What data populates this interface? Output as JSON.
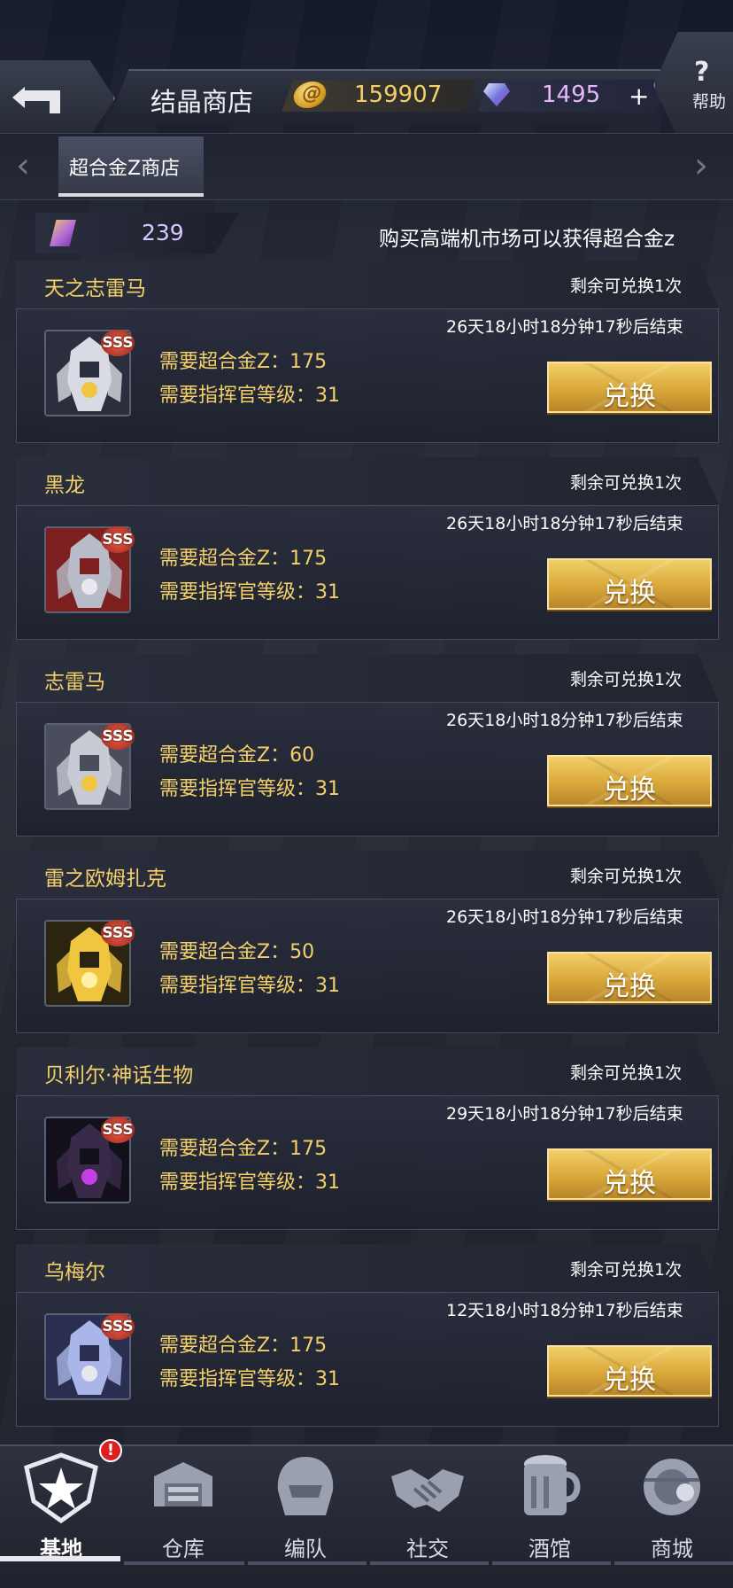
{
  "header": {
    "title": "结晶商店",
    "gold": "159907",
    "gems": "1495",
    "plus": "+",
    "help_label": "帮助",
    "help_glyph": "?"
  },
  "tabs": {
    "items": [
      {
        "label": "超合金Z商店",
        "active": true
      }
    ],
    "left_arrow": "‹",
    "right_arrow": "›"
  },
  "balance": {
    "alloy_count": "239",
    "hint": "购买高端机市场可以获得超合金z"
  },
  "items": [
    {
      "name": "天之志雷马",
      "remain": "剩余可兑换1次",
      "timer": "26天18小时18分钟17秒后结束",
      "rank": "SSS",
      "req_alloy": "需要超合金Z：175",
      "req_level": "需要指挥官等级：31",
      "button": "兑换",
      "portrait": "white-mecha"
    },
    {
      "name": "黑龙",
      "remain": "剩余可兑换1次",
      "timer": "26天18小时18分钟17秒后结束",
      "rank": "SSS",
      "req_alloy": "需要超合金Z：175",
      "req_level": "需要指挥官等级：31",
      "button": "兑换",
      "portrait": "red-mecha"
    },
    {
      "name": "志雷马",
      "remain": "剩余可兑换1次",
      "timer": "26天18小时18分钟17秒后结束",
      "rank": "SSS",
      "req_alloy": "需要超合金Z：60",
      "req_level": "需要指挥官等级：31",
      "button": "兑换",
      "portrait": "silver-mecha"
    },
    {
      "name": "雷之欧姆扎克",
      "remain": "剩余可兑换1次",
      "timer": "26天18小时18分钟17秒后结束",
      "rank": "SSS",
      "req_alloy": "需要超合金Z：50",
      "req_level": "需要指挥官等级：31",
      "button": "兑换",
      "portrait": "yellow-mecha"
    },
    {
      "name": "贝利尔·神话生物",
      "remain": "剩余可兑换1次",
      "timer": "29天18小时18分钟17秒后结束",
      "rank": "SSS",
      "req_alloy": "需要超合金Z：175",
      "req_level": "需要指挥官等级：31",
      "button": "兑换",
      "portrait": "dark-mecha"
    },
    {
      "name": "乌梅尔",
      "remain": "剩余可兑换1次",
      "timer": "12天18小时18分钟17秒后结束",
      "rank": "SSS",
      "req_alloy": "需要超合金Z：175",
      "req_level": "需要指挥官等级：31",
      "button": "兑换",
      "portrait": "blue-mecha"
    }
  ],
  "bottom_nav": {
    "items": [
      {
        "label": "基地",
        "icon": "star-badge-icon",
        "active": true
      },
      {
        "label": "仓库",
        "icon": "warehouse-icon",
        "active": false
      },
      {
        "label": "编队",
        "icon": "helmet-icon",
        "active": false
      },
      {
        "label": "社交",
        "icon": "handshake-icon",
        "active": false
      },
      {
        "label": "酒馆",
        "icon": "mug-icon",
        "active": false
      },
      {
        "label": "商城",
        "icon": "shop-orb-icon",
        "active": false
      }
    ],
    "alert_badge": "!"
  },
  "colors": {
    "accent_gold": "#f3d06a",
    "button_gold": "#d9a83a",
    "gem_pink": "#e6b7ff",
    "alert_red": "#e01e1e"
  }
}
